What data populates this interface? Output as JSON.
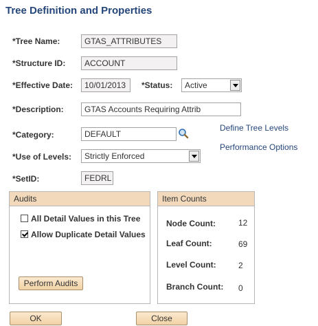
{
  "page": {
    "title": "Tree Definition and Properties"
  },
  "form": {
    "tree_name": {
      "label": "*Tree Name:",
      "value": "GTAS_ATTRIBUTES"
    },
    "structure_id": {
      "label": "*Structure ID:",
      "value": "ACCOUNT"
    },
    "effective_date": {
      "label": "*Effective Date:",
      "value": "10/01/2013"
    },
    "status": {
      "label": "*Status:",
      "value": "Active"
    },
    "description": {
      "label": "*Description:",
      "value": "GTAS Accounts Requiring Attrib"
    },
    "category": {
      "label": "*Category:",
      "value": "DEFAULT"
    },
    "use_of_levels": {
      "label": "*Use of Levels:",
      "value": "Strictly Enforced"
    },
    "setid": {
      "label": "*SetID:",
      "value": "FEDRL"
    }
  },
  "links": {
    "define_tree_levels": "Define Tree Levels",
    "performance_options": "Performance Options"
  },
  "audits": {
    "header": "Audits",
    "all_detail_values": {
      "label": "All Detail Values in this Tree",
      "checked": false
    },
    "allow_duplicate": {
      "label": "Allow Duplicate Detail Values",
      "checked": true
    },
    "perform_button": "Perform Audits"
  },
  "item_counts": {
    "header": "Item Counts",
    "node": {
      "label": "Node Count:",
      "value": "12"
    },
    "leaf": {
      "label": "Leaf Count:",
      "value": "69"
    },
    "level": {
      "label": "Level Count:",
      "value": "2"
    },
    "branch": {
      "label": "Branch Count:",
      "value": "0"
    }
  },
  "buttons": {
    "ok": "OK",
    "close": "Close"
  },
  "colors": {
    "title": "#24467a",
    "group_header": "#f2d9bb",
    "button_top": "#fbe9cf",
    "button_bottom": "#f2d2a5",
    "disabled_field": "#f3f1f1"
  },
  "icons": {
    "category_lookup": "magnifier-icon",
    "dropdown": "chevron-down-icon"
  }
}
